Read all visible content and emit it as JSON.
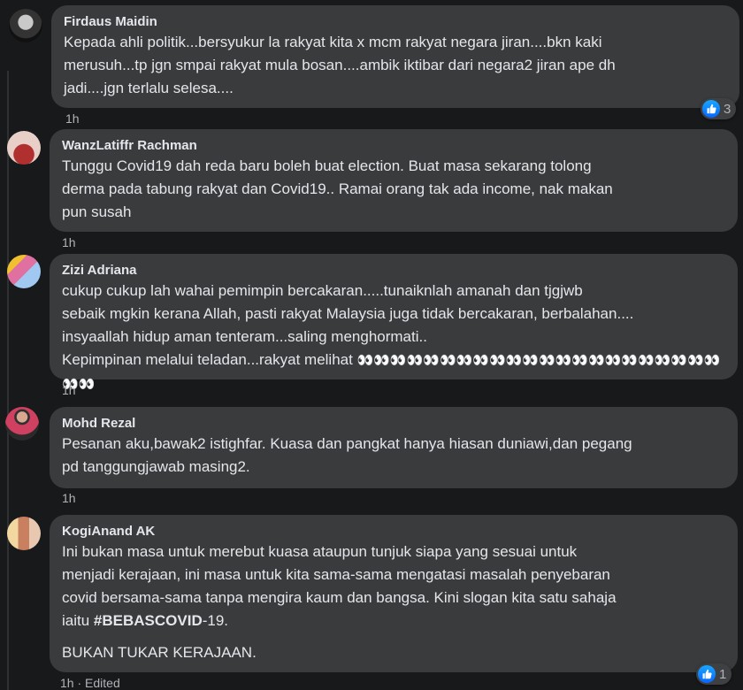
{
  "comments": [
    {
      "author": "Firdaus Maidin",
      "lines": [
        "Kepada ahli politik...bersyukur la rakyat kita x mcm rakyat negara jiran....bkn kaki",
        "merusuh...tp jgn smpai rakyat mula bosan....ambik iktibar dari negara2 jiran ape dh",
        "jadi....jgn terlalu selesa...."
      ],
      "time": "1h",
      "reactions": "3"
    },
    {
      "author": "WanzLatiffr Rachman",
      "lines": [
        "Tunggu Covid19 dah reda baru boleh buat election. Buat masa sekarang tolong",
        "derma pada tabung rakyat dan Covid19.. Ramai orang tak ada income, nak makan",
        "pun susah"
      ],
      "time": "1h"
    },
    {
      "author": "Zizi Adriana",
      "lines": [
        "cukup cukup lah wahai pemimpin bercakaran.....tunaiknlah amanah dan tjgjwb",
        "sebaik mgkin kerana Allah, pasti rakyat Malaysia juga tidak bercakaran, berbalahan....",
        "insyaallah hidup aman tenteram...saling menghormati..",
        "Kepimpinan melalui teladan...rakyat melihat"
      ],
      "emoji_run": "👀👀👀👀👀👀👀👀👀👀👀👀👀👀👀👀👀👀👀👀👀👀👀👀",
      "time": "1h"
    },
    {
      "author": "Mohd Rezal",
      "lines": [
        "Pesanan aku,bawak2 istighfar. Kuasa dan pangkat hanya hiasan duniawi,dan pegang",
        "pd tanggungjawab masing2."
      ],
      "time": "1h"
    },
    {
      "author": "KogiAnand AK",
      "lines": [
        "Ini bukan masa untuk merebut kuasa ataupun tunjuk siapa yang sesuai untuk",
        "menjadi kerajaan, ini masa untuk kita sama-sama mengatasi masalah penyebaran",
        "covid bersama-sama tanpa mengira kaum dan bangsa. Kini slogan kita satu sahaja",
        "iaitu "
      ],
      "hashtag": "#BEBASCOVID",
      "hashtag_suffix": "-19.",
      "second_paragraph": "BUKAN TUKAR KERAJAAN.",
      "time": "1h",
      "edited": "Edited",
      "reactions": "1"
    }
  ],
  "colors": {
    "background": "#18191a",
    "bubble": "#3a3b3c",
    "text": "#e4e6eb",
    "meta": "#b0b3b8",
    "like": "#0866ff"
  }
}
